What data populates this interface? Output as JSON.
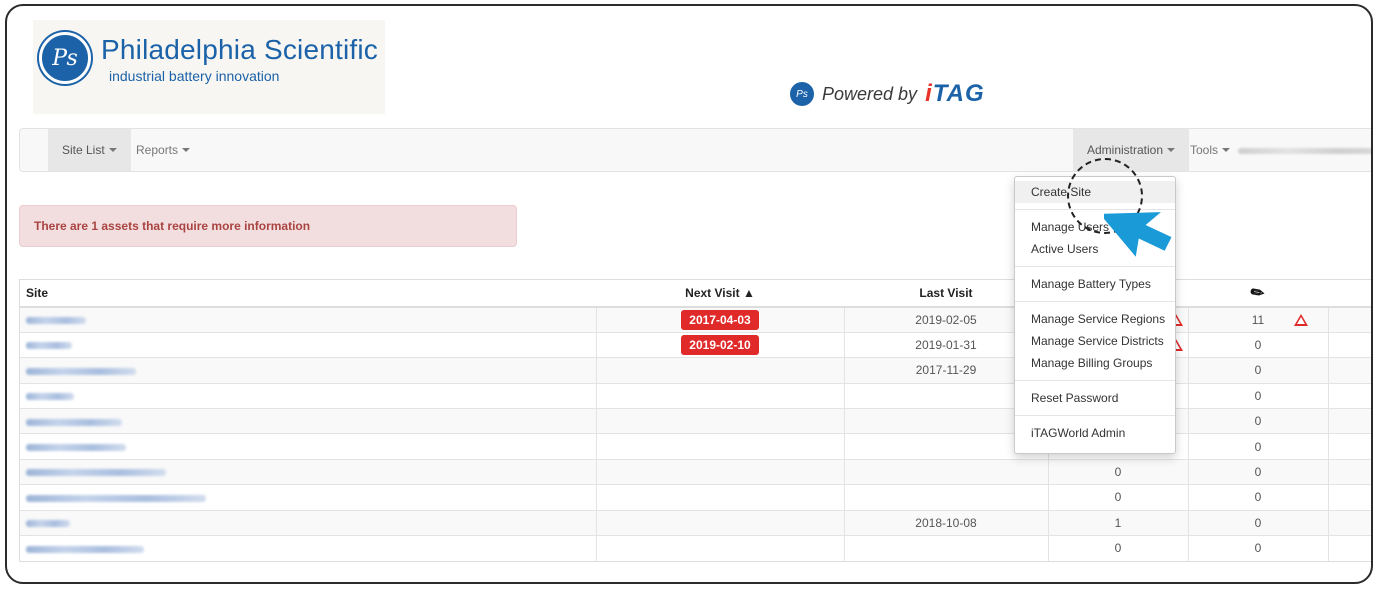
{
  "header": {
    "logo_monogram": "Ps",
    "logo_name": "Philadelphia Scientific",
    "logo_tagline": "industrial battery innovation",
    "powered_by": "Powered by",
    "brand_i": "i",
    "brand_rest": "TAG"
  },
  "nav": {
    "site_list": "Site List",
    "reports": "Reports",
    "administration": "Administration",
    "tools": "Tools"
  },
  "alert": {
    "text": "There are 1 assets that require more information"
  },
  "table": {
    "headers": {
      "site": "Site",
      "next_visit": "Next Visit ▲",
      "last_visit": "Last Visit",
      "col4": "",
      "col5_icon": "plug-icon"
    },
    "rows": [
      {
        "next_visit": "2017-04-03",
        "last_visit": "2019-02-05",
        "c4": "",
        "c5": "11",
        "warn4": true,
        "warn5": true
      },
      {
        "next_visit": "2019-02-10",
        "last_visit": "2019-01-31",
        "c4": "",
        "c5": "0",
        "warn4": true,
        "warn5": false
      },
      {
        "next_visit": "",
        "last_visit": "2017-11-29",
        "c4": "",
        "c5": "0"
      },
      {
        "next_visit": "",
        "last_visit": "",
        "c4": "",
        "c5": "0"
      },
      {
        "next_visit": "",
        "last_visit": "",
        "c4": "",
        "c5": "0"
      },
      {
        "next_visit": "",
        "last_visit": "",
        "c4": "",
        "c5": "0"
      },
      {
        "next_visit": "",
        "last_visit": "",
        "c4": "0",
        "c5": "0"
      },
      {
        "next_visit": "",
        "last_visit": "",
        "c4": "0",
        "c5": "0"
      },
      {
        "next_visit": "",
        "last_visit": "2018-10-08",
        "c4": "1",
        "c5": "0"
      },
      {
        "next_visit": "",
        "last_visit": "",
        "c4": "0",
        "c5": "0"
      }
    ]
  },
  "dropdown": {
    "create_site": "Create Site",
    "manage_users": "Manage Users",
    "active_users": "Active Users",
    "manage_battery_types": "Manage Battery Types",
    "manage_service_regions": "Manage Service Regions",
    "manage_service_districts": "Manage Service Districts",
    "manage_billing_groups": "Manage Billing Groups",
    "reset_password": "Reset Password",
    "itagworld_admin": "iTAGWorld Admin"
  },
  "colors": {
    "brand_blue": "#1b62a8",
    "alert_red": "#e02a2a",
    "pointer_blue": "#1a9bd7"
  }
}
